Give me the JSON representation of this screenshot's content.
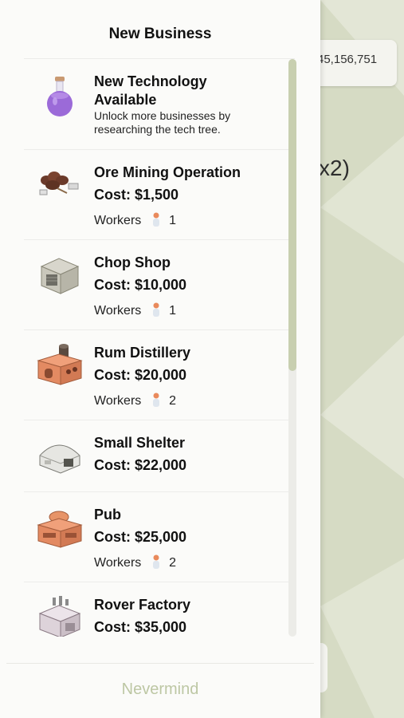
{
  "background": {
    "money": "45,156,751",
    "multiplier": "x2)"
  },
  "panel": {
    "title": "New Business",
    "tech": {
      "title": "New Technology Available",
      "description": "Unlock more businesses by researching the tech tree.",
      "icon": "potion-flask-icon"
    },
    "workers_label": "Workers",
    "items": [
      {
        "name": "Ore Mining Operation",
        "cost": "Cost: $1,500",
        "workers": "1",
        "icon": "ore-mine-icon"
      },
      {
        "name": "Chop Shop",
        "cost": "Cost: $10,000",
        "workers": "1",
        "icon": "chop-shop-icon"
      },
      {
        "name": "Rum Distillery",
        "cost": "Cost: $20,000",
        "workers": "2",
        "icon": "distillery-icon"
      },
      {
        "name": "Small Shelter",
        "cost": "Cost: $22,000",
        "icon": "shelter-icon"
      },
      {
        "name": "Pub",
        "cost": "Cost: $25,000",
        "workers": "2",
        "icon": "pub-icon"
      },
      {
        "name": "Rover Factory",
        "cost": "Cost: $35,000",
        "icon": "rover-factory-icon"
      }
    ],
    "scroll_fraction": 0.54,
    "nevermind_label": "Nevermind"
  },
  "colors": {
    "accent": "#bdc7a4",
    "scroll_thumb": "#c8cfb0",
    "background": "#d6dbc4"
  }
}
